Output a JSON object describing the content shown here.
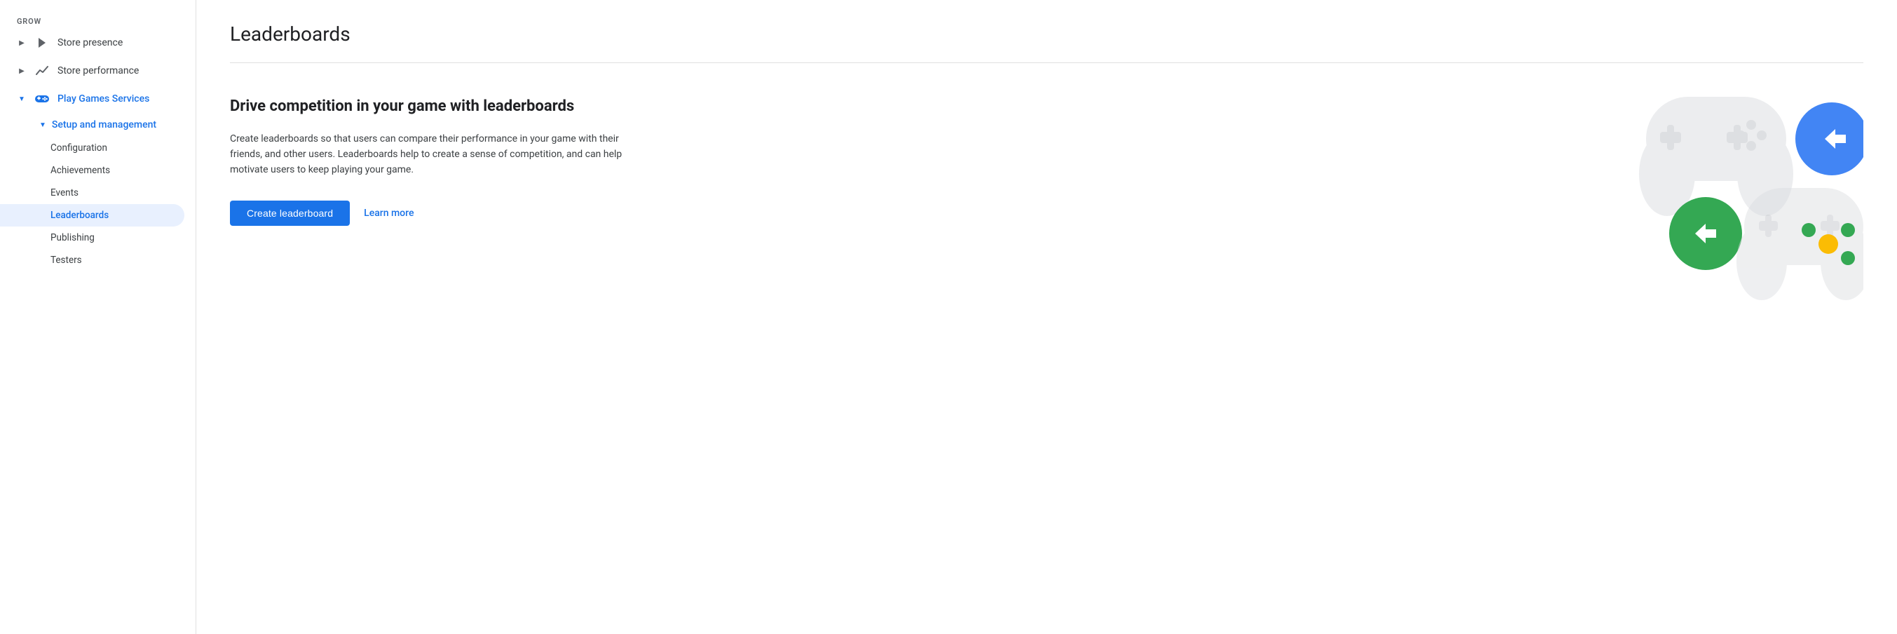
{
  "sidebar": {
    "section_label": "Grow",
    "items": [
      {
        "id": "store-presence",
        "label": "Store presence",
        "icon": "play-icon",
        "expanded": false,
        "chevron": "▶"
      },
      {
        "id": "store-performance",
        "label": "Store performance",
        "icon": "chart-icon",
        "expanded": false,
        "chevron": "▶"
      },
      {
        "id": "play-games-services",
        "label": "Play Games Services",
        "icon": "gamepad-icon",
        "expanded": true,
        "chevron": "▼",
        "subitems": [
          {
            "id": "setup-management",
            "label": "Setup and management",
            "expanded": true,
            "chevron": "▼",
            "subsubitems": [
              {
                "id": "configuration",
                "label": "Configuration",
                "active": false
              },
              {
                "id": "achievements",
                "label": "Achievements",
                "active": false
              },
              {
                "id": "events",
                "label": "Events",
                "active": false
              },
              {
                "id": "leaderboards",
                "label": "Leaderboards",
                "active": true
              },
              {
                "id": "publishing",
                "label": "Publishing",
                "active": false
              },
              {
                "id": "testers",
                "label": "Testers",
                "active": false
              }
            ]
          }
        ]
      }
    ]
  },
  "main": {
    "title": "Leaderboards",
    "content_heading": "Drive competition in your game with leaderboards",
    "content_description": "Create leaderboards so that users can compare their performance in your game with their friends, and other users. Leaderboards help to create a sense of competition, and can help motivate users to keep playing your game.",
    "create_button_label": "Create leaderboard",
    "learn_more_label": "Learn more"
  }
}
